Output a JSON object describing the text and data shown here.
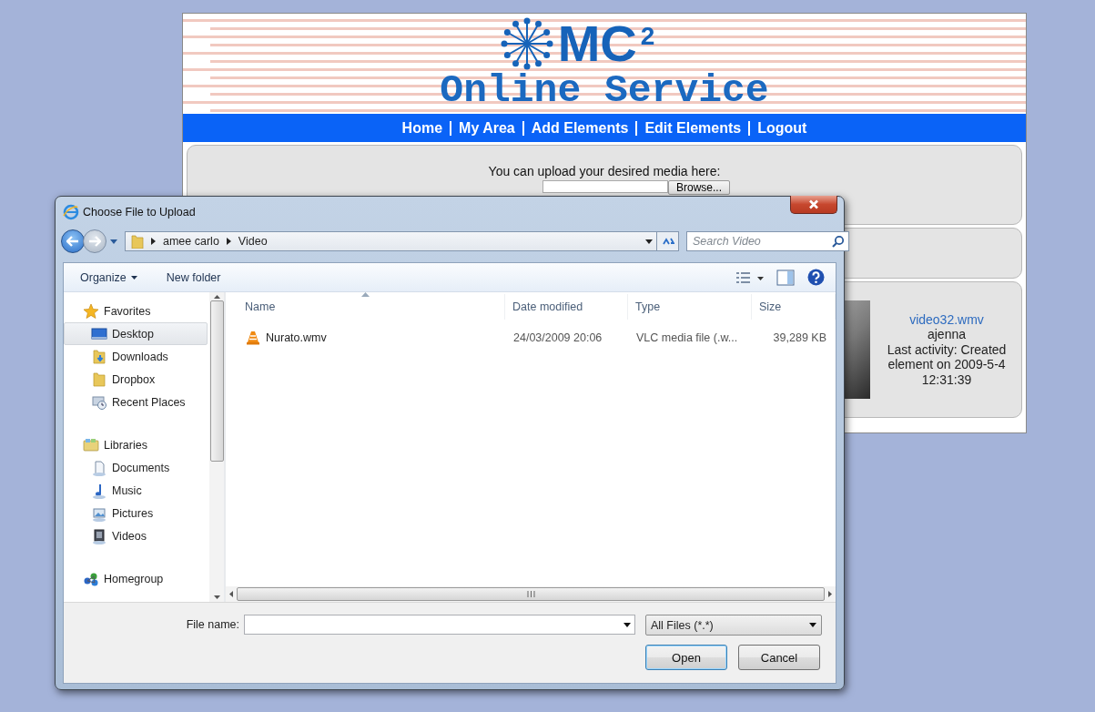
{
  "web_page": {
    "logo": {
      "mark": "MC",
      "superscript": "2",
      "tagline": "Online Service"
    },
    "nav_links": [
      "Home",
      "My Area",
      "Add Elements",
      "Edit Elements",
      "Logout"
    ],
    "upload_panel": {
      "prompt": "You can upload your desired media here:",
      "browse_button": "Browse..."
    },
    "element_card": {
      "link": "video32.wmv",
      "user": "ajenna",
      "activity": "Last activity: Created element on 2009-5-4 12:31:39"
    }
  },
  "dialog": {
    "title": "Choose File to Upload",
    "breadcrumb": [
      "amee carlo",
      "Video"
    ],
    "search": {
      "placeholder": "Search Video"
    },
    "toolbar": [
      {
        "label": "Organize",
        "menu": true
      },
      {
        "label": "New folder",
        "menu": false
      }
    ],
    "nav": [
      {
        "label": "Favorites",
        "selected": false,
        "children": [
          {
            "label": "Desktop",
            "selected": true
          },
          {
            "label": "Downloads",
            "selected": false
          },
          {
            "label": "Dropbox",
            "selected": false
          },
          {
            "label": "Recent Places",
            "selected": false
          }
        ]
      },
      {
        "label": "Libraries",
        "selected": false,
        "children": [
          {
            "label": "Documents",
            "selected": false
          },
          {
            "label": "Music",
            "selected": false
          },
          {
            "label": "Pictures",
            "selected": false
          },
          {
            "label": "Videos",
            "selected": false
          }
        ]
      },
      {
        "label": "Homegroup",
        "selected": false
      }
    ],
    "columns": [
      {
        "label": "Name",
        "sorted": true
      },
      {
        "label": "Date modified",
        "sorted": false
      },
      {
        "label": "Type",
        "sorted": false
      },
      {
        "label": "Size",
        "sorted": false
      }
    ],
    "rows": [
      {
        "cells": [
          "Nurato.wmv",
          "24/03/2009 20:06",
          "VLC media file (.w...",
          "39,289 KB"
        ],
        "selected": false
      }
    ],
    "file_name": {
      "label": "File name:"
    },
    "file_type": "All Files (*.*)",
    "buttons": [
      {
        "label": "Open",
        "default": true
      },
      {
        "label": "Cancel",
        "default": false
      }
    ]
  }
}
